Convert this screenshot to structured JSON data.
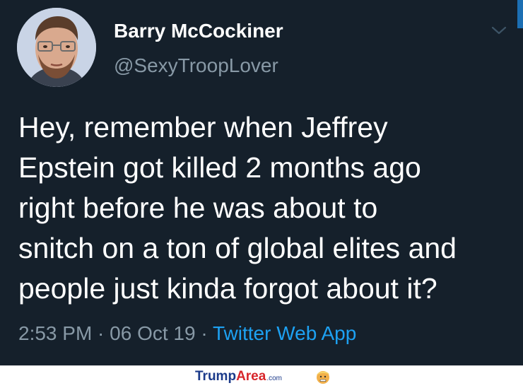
{
  "tweet": {
    "author_name": "Barry McCockiner",
    "author_handle": "@SexyTroopLover",
    "text_lines": [
      "Hey, remember when Jeffrey",
      "Epstein got killed 2 months ago",
      "right before he was about to",
      "snitch on a ton of global elites and",
      "people just kinda forgot about it?"
    ],
    "time": "2:53 PM",
    "separator": " · ",
    "date": "06 Oct 19",
    "source": "Twitter Web App"
  },
  "watermark": {
    "part1": "Trump",
    "part2": "Area",
    "part3": ".com"
  },
  "colors": {
    "background": "#15202b",
    "text": "#ffffff",
    "secondary_text": "#8899a6",
    "link": "#1da1f2",
    "brand_blue": "#1b3a8a",
    "brand_red": "#d8262b"
  },
  "icons": {
    "menu": "chevron-down-icon",
    "brand": "trump-face-icon"
  }
}
